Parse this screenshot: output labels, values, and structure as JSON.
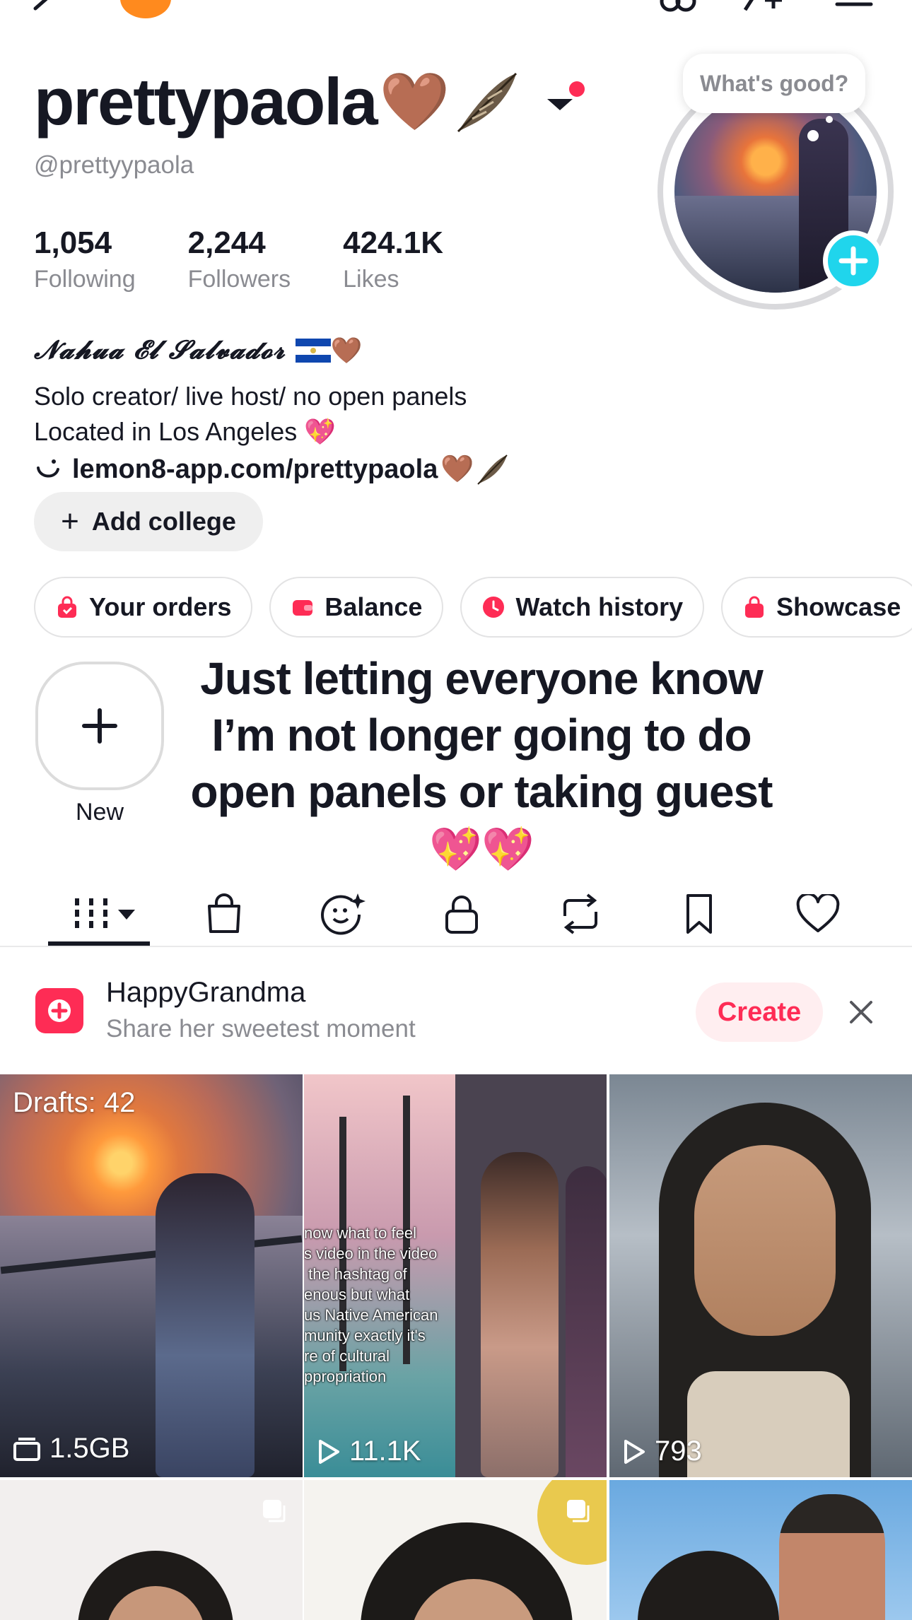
{
  "profile": {
    "display_name": "prettypaola",
    "handle": "@prettyypaola",
    "speech_bubble": "What's good?",
    "stats": [
      {
        "value": "1,054",
        "label": "Following"
      },
      {
        "value": "2,244",
        "label": "Followers"
      },
      {
        "value": "424.1K",
        "label": "Likes"
      }
    ],
    "bio": {
      "line1": "𝓝𝓪𝓱𝓾𝓪 𝓔𝓵 𝓢𝓪𝓵𝓿𝓪𝓭𝓸𝓻",
      "line2": "Solo creator/ live host/ no open panels",
      "line3": "Located in Los Angeles",
      "link": "lemon8-app.com/prettypaola"
    },
    "add_college": "Add college"
  },
  "chips": [
    {
      "label": "Your orders",
      "icon": "shopping-bag-icon"
    },
    {
      "label": "Balance",
      "icon": "wallet-icon"
    },
    {
      "label": "Watch history",
      "icon": "clock-icon"
    },
    {
      "label": "Showcase",
      "icon": "shopping-bag-icon"
    }
  ],
  "story": {
    "new_label": "New",
    "pinned_text": "Just letting everyone know I’m not longer going to do open panels or taking guest"
  },
  "tabs": [
    {
      "icon": "videos-grid-icon",
      "active": true
    },
    {
      "icon": "shop-bag-icon"
    },
    {
      "icon": "ai-face-icon"
    },
    {
      "icon": "lock-icon"
    },
    {
      "icon": "repost-icon"
    },
    {
      "icon": "bookmark-icon"
    },
    {
      "icon": "heart-icon"
    }
  ],
  "banner": {
    "title": "HappyGrandma",
    "subtitle": "Share her sweetest moment",
    "create": "Create"
  },
  "grid": {
    "drafts_label": "Drafts: 42",
    "items": [
      {
        "stat": "1.5GB",
        "icon": "drafts-box-icon"
      },
      {
        "stat": "11.1K",
        "icon": "play-icon",
        "overlay": "now what to feel\ns video in the video\n the hashtag of\nenous but what\nus Native American\nmunity exactly it's\nre of cultural\nppropriation"
      },
      {
        "stat": "793",
        "icon": "play-icon"
      }
    ]
  },
  "colors": {
    "accent": "#fe2c55",
    "plus_blue": "#20d5ec",
    "muted_text": "#8a8b91"
  }
}
